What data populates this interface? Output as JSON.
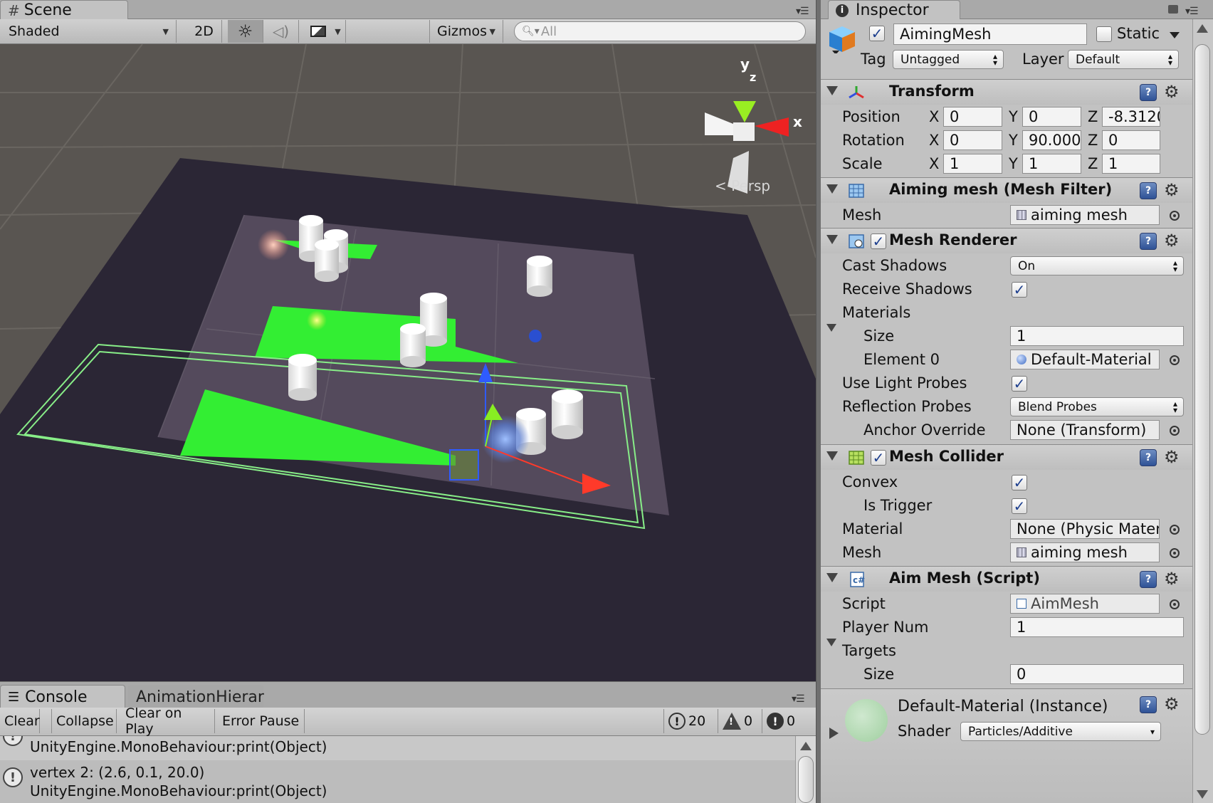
{
  "scene": {
    "tab_label": "Scene",
    "shading_mode": "Shaded",
    "mode_2d": "2D",
    "gizmos_label": "Gizmos",
    "search_placeholder": "All",
    "gizmo_y": "y",
    "gizmo_x": "x",
    "gizmo_z": "z",
    "projection": "Persp"
  },
  "console": {
    "tabs": [
      "Console",
      "AnimationHierar"
    ],
    "buttons": {
      "clear": "Clear",
      "collapse": "Collapse",
      "clear_on_play": "Clear on Play",
      "error_pause": "Error Pause"
    },
    "counts": {
      "info": "20",
      "warnings": "0",
      "errors": "0"
    },
    "log": [
      {
        "lines": [
          "UnityEngine.MonoBehaviour:print(Object)"
        ]
      },
      {
        "lines": [
          "vertex 2: (2.6, 0.1, 20.0)",
          "UnityEngine.MonoBehaviour:print(Object)"
        ]
      }
    ]
  },
  "inspector": {
    "tab_label": "Inspector",
    "object_name": "AimingMesh",
    "static_label": "Static",
    "tag_label": "Tag",
    "tag_value": "Untagged",
    "layer_label": "Layer",
    "layer_value": "Default",
    "transform": {
      "title": "Transform",
      "position_label": "Position",
      "rotation_label": "Rotation",
      "scale_label": "Scale",
      "axis_x": "X",
      "axis_y": "Y",
      "axis_z": "Z",
      "position": {
        "x": "0",
        "y": "0",
        "z": "-8.3120"
      },
      "rotation": {
        "x": "0",
        "y": "90.0000",
        "z": "0"
      },
      "scale": {
        "x": "1",
        "y": "1",
        "z": "1"
      }
    },
    "mesh_filter": {
      "title": "Aiming mesh (Mesh Filter)",
      "mesh_label": "Mesh",
      "mesh_value": "aiming mesh"
    },
    "mesh_renderer": {
      "title": "Mesh Renderer",
      "cast_shadows_label": "Cast Shadows",
      "cast_shadows_value": "On",
      "receive_shadows_label": "Receive Shadows",
      "materials_label": "Materials",
      "size_label": "Size",
      "size_value": "1",
      "element0_label": "Element 0",
      "element0_value": "Default-Material",
      "light_probes_label": "Use Light Probes",
      "reflection_label": "Reflection Probes",
      "reflection_value": "Blend Probes",
      "anchor_label": "Anchor Override",
      "anchor_value": "None (Transform)"
    },
    "mesh_collider": {
      "title": "Mesh Collider",
      "convex_label": "Convex",
      "trigger_label": "Is Trigger",
      "material_label": "Material",
      "material_value": "None (Physic Mater",
      "mesh_label": "Mesh",
      "mesh_value": "aiming mesh"
    },
    "aim_mesh": {
      "title": "Aim Mesh (Script)",
      "script_label": "Script",
      "script_value": "AimMesh",
      "player_label": "Player Num",
      "player_value": "1",
      "targets_label": "Targets",
      "size_label": "Size",
      "size_value": "0"
    },
    "material": {
      "title": "Default-Material (Instance)",
      "shader_label": "Shader",
      "shader_value": "Particles/Additive"
    }
  },
  "colors": {
    "accent": "#1d3f8e",
    "green_mesh": "#33ee33",
    "floor": "#2b2635",
    "plane": "#544a5c"
  }
}
